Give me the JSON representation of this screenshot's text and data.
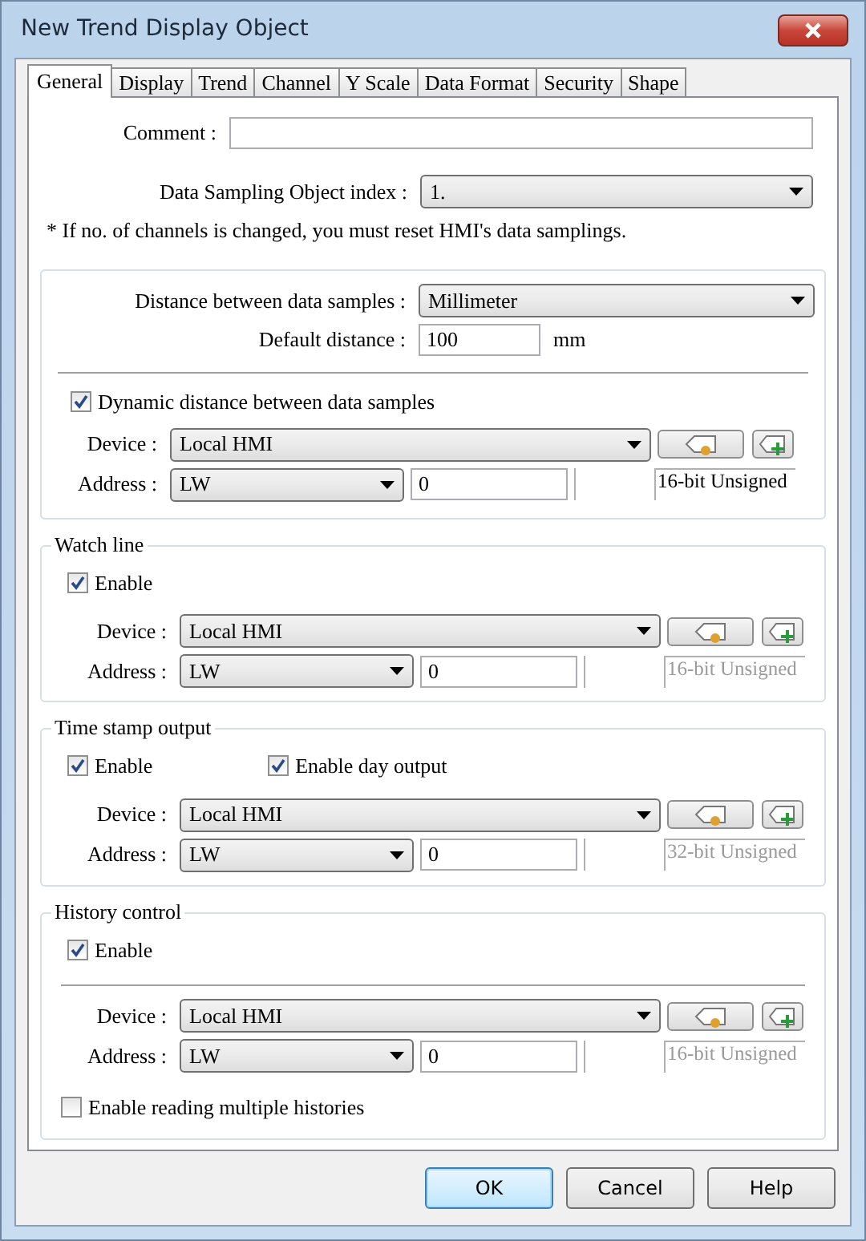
{
  "window": {
    "title": "New Trend Display Object"
  },
  "tabs": [
    {
      "label": "General",
      "selected": true
    },
    {
      "label": "Display",
      "selected": false
    },
    {
      "label": "Trend",
      "selected": false
    },
    {
      "label": "Channel",
      "selected": false
    },
    {
      "label": "Y Scale",
      "selected": false
    },
    {
      "label": "Data Format",
      "selected": false
    },
    {
      "label": "Security",
      "selected": false
    },
    {
      "label": "Shape",
      "selected": false
    }
  ],
  "comment": {
    "label": "Comment :"
  },
  "sampling_index": {
    "label": "Data Sampling Object index :",
    "value": "1."
  },
  "note": "* If no. of channels is changed, you must reset HMI's data samplings.",
  "distance": {
    "label": "Distance between data samples :",
    "value": "Millimeter"
  },
  "default_distance": {
    "label": "Default distance :",
    "value": "100",
    "unit": "mm"
  },
  "dynamic_distance": {
    "label": "Dynamic distance between data samples",
    "checked": true,
    "source": {
      "device_label": "Device :",
      "device": "Local HMI",
      "address_label": "Address :",
      "address_type": "LW",
      "address": "0",
      "data_type": "16-bit Unsigned",
      "type_disabled": false
    }
  },
  "sections": [
    {
      "title": "Watch line",
      "options": [
        {
          "label": "Enable",
          "checked": true
        }
      ],
      "divider": false,
      "source": {
        "device_label": "Device :",
        "device": "Local HMI",
        "address_label": "Address :",
        "address_type": "LW",
        "address": "0",
        "data_type": "16-bit Unsigned",
        "type_disabled": true
      }
    },
    {
      "title": "Time stamp output",
      "options": [
        {
          "label": "Enable",
          "checked": true
        },
        {
          "label": "Enable day output",
          "checked": true
        }
      ],
      "divider": false,
      "source": {
        "device_label": "Device :",
        "device": "Local HMI",
        "address_label": "Address :",
        "address_type": "LW",
        "address": "0",
        "data_type": "32-bit Unsigned",
        "type_disabled": true
      }
    },
    {
      "title": "History control",
      "options": [
        {
          "label": "Enable",
          "checked": true
        }
      ],
      "divider": true,
      "source": {
        "device_label": "Device :",
        "device": "Local HMI",
        "address_label": "Address :",
        "address_type": "LW",
        "address": "0",
        "data_type": "16-bit Unsigned",
        "type_disabled": true
      },
      "extra_options": [
        {
          "label": "Enable reading multiple histories",
          "checked": false
        }
      ]
    }
  ],
  "buttons": [
    {
      "label": "OK",
      "default": true
    },
    {
      "label": "Cancel",
      "default": false
    },
    {
      "label": "Help",
      "default": false
    }
  ]
}
